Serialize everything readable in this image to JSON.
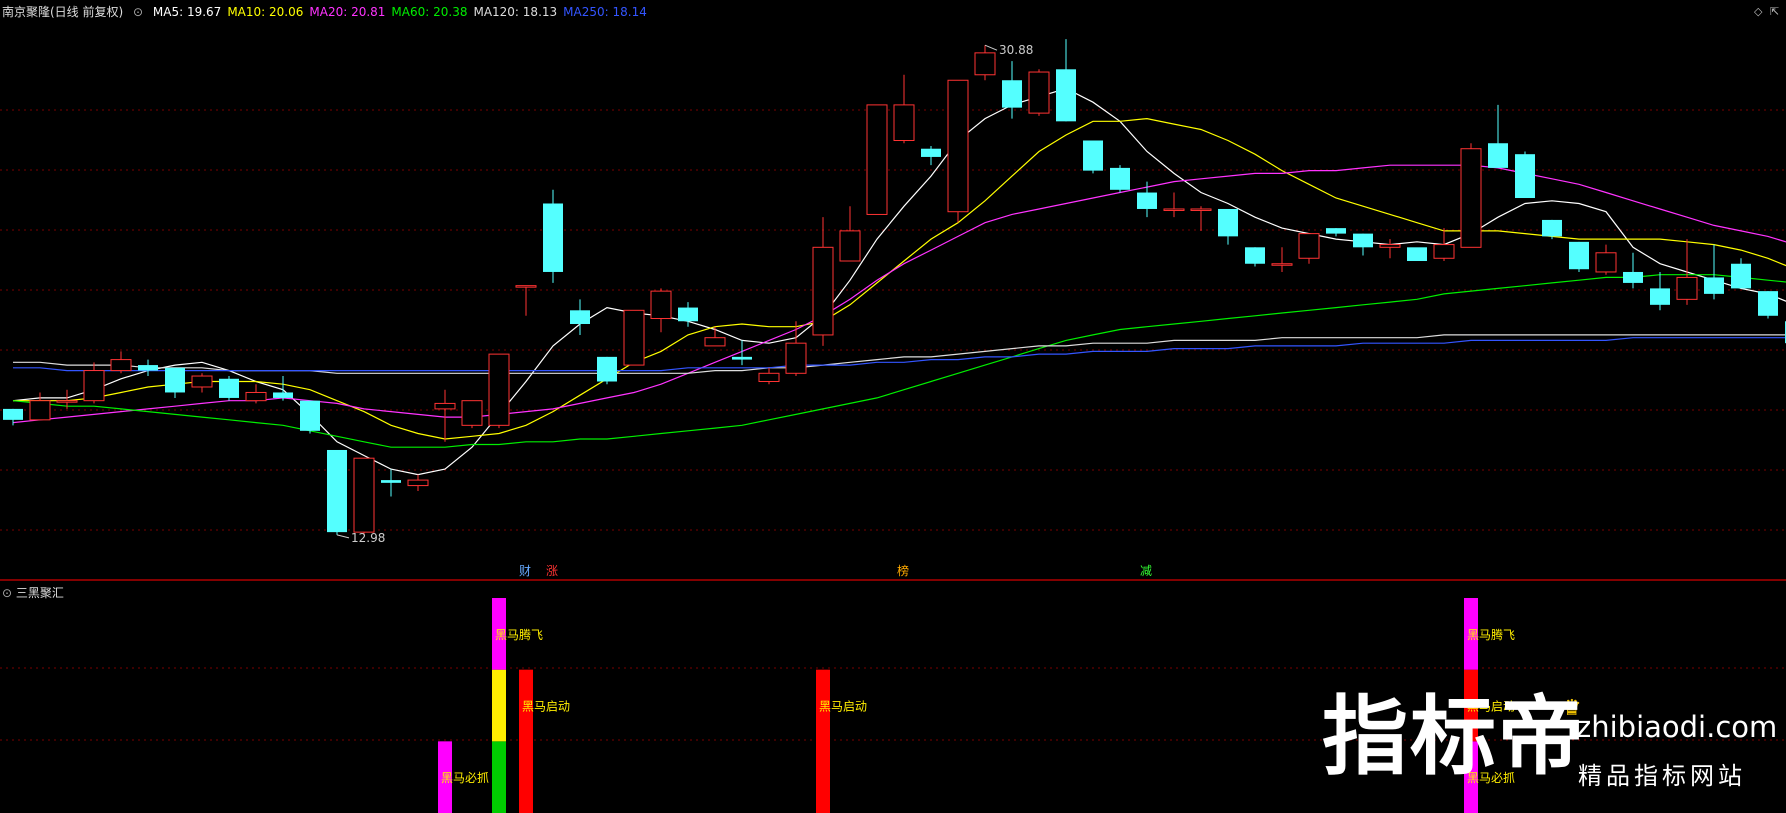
{
  "header": {
    "stock_title": "南京聚隆(日线 前复权)",
    "indicators": [
      {
        "label": "MA5: 19.67",
        "color": "#ffffff"
      },
      {
        "label": "MA10: 20.06",
        "color": "#ffff00"
      },
      {
        "label": "MA20: 20.81",
        "color": "#ff33ff"
      },
      {
        "label": "MA60: 20.38",
        "color": "#00ee00"
      },
      {
        "label": "MA120: 18.13",
        "color": "#dddddd"
      },
      {
        "label": "MA250: 18.14",
        "color": "#3355ff"
      }
    ]
  },
  "sub_panel": {
    "title": "三黑聚汇"
  },
  "watermark": {
    "brand": "指标帝",
    "url": "zhibiaodi.com",
    "slogan": "精品指标网站"
  },
  "colors": {
    "up": "#ff3333",
    "down": "#54ffff",
    "grid": "#7a0000",
    "divider": "#b00000"
  },
  "chart_data": [
    {
      "type": "candlestick",
      "price_range": [
        11.9,
        31.8
      ],
      "high_label": "30.88",
      "low_label": "12.98",
      "candles": [
        [
          17.6,
          17.6,
          17.0,
          17.2
        ],
        [
          17.2,
          18.2,
          17.2,
          17.9
        ],
        [
          17.9,
          18.3,
          17.6,
          17.9
        ],
        [
          17.9,
          19.3,
          17.8,
          19.0
        ],
        [
          19.0,
          19.7,
          18.9,
          19.4
        ],
        [
          19.2,
          19.4,
          18.8,
          19.0
        ],
        [
          19.1,
          19.1,
          18.0,
          18.2
        ],
        [
          18.4,
          18.9,
          18.2,
          18.8
        ],
        [
          18.7,
          18.8,
          17.9,
          18.0
        ],
        [
          17.9,
          18.5,
          17.8,
          18.2
        ],
        [
          18.2,
          18.8,
          17.9,
          18.0
        ],
        [
          17.9,
          17.9,
          16.7,
          16.8
        ],
        [
          16.1,
          16.1,
          13.0,
          13.1
        ],
        [
          13.1,
          15.8,
          13.0,
          15.8
        ],
        [
          15.0,
          15.4,
          14.4,
          14.9
        ],
        [
          14.8,
          15.2,
          14.6,
          15.0
        ],
        [
          17.6,
          18.3,
          16.4,
          17.8
        ],
        [
          17.0,
          17.9,
          16.9,
          17.9
        ],
        [
          17.0,
          19.6,
          16.9,
          19.6
        ],
        [
          22.1,
          22.1,
          21.0,
          22.1
        ],
        [
          25.1,
          25.6,
          22.2,
          22.6
        ],
        [
          21.2,
          21.6,
          20.3,
          20.7
        ],
        [
          19.5,
          19.5,
          18.5,
          18.6
        ],
        [
          19.2,
          21.2,
          19.2,
          21.2
        ],
        [
          20.9,
          22.0,
          20.4,
          21.9
        ],
        [
          21.3,
          21.5,
          20.6,
          20.8
        ],
        [
          19.9,
          20.6,
          19.9,
          20.2
        ],
        [
          19.5,
          20.1,
          19.2,
          19.4
        ],
        [
          18.6,
          19.1,
          18.5,
          18.9
        ],
        [
          18.9,
          20.8,
          18.8,
          20.0
        ],
        [
          20.3,
          24.6,
          19.9,
          23.5
        ],
        [
          23.0,
          25.0,
          23.0,
          24.1
        ],
        [
          24.7,
          28.0,
          24.7,
          28.7
        ],
        [
          27.4,
          29.8,
          27.3,
          28.7
        ],
        [
          27.1,
          27.2,
          26.5,
          26.8
        ],
        [
          24.8,
          29.6,
          24.4,
          29.6
        ],
        [
          29.8,
          30.88,
          29.6,
          30.6
        ],
        [
          29.6,
          30.3,
          28.2,
          28.6
        ],
        [
          28.4,
          30.0,
          28.3,
          29.9
        ],
        [
          30.0,
          31.1,
          28.1,
          28.1
        ],
        [
          27.4,
          27.4,
          26.2,
          26.3
        ],
        [
          26.4,
          26.5,
          25.5,
          25.6
        ],
        [
          25.5,
          25.9,
          24.6,
          24.9
        ],
        [
          24.9,
          25.5,
          24.6,
          24.9
        ],
        [
          24.9,
          25.0,
          24.1,
          24.9
        ],
        [
          24.9,
          24.9,
          23.6,
          23.9
        ],
        [
          23.5,
          23.5,
          22.8,
          22.9
        ],
        [
          22.9,
          23.5,
          22.6,
          22.9
        ],
        [
          23.1,
          24.0,
          22.9,
          24.0
        ],
        [
          24.2,
          24.2,
          23.9,
          24.0
        ],
        [
          24.0,
          24.0,
          23.2,
          23.5
        ],
        [
          23.5,
          23.8,
          23.1,
          23.6
        ],
        [
          23.5,
          23.5,
          23.5,
          23.0
        ],
        [
          23.1,
          24.2,
          23.0,
          23.6
        ],
        [
          23.5,
          27.3,
          23.5,
          27.1
        ],
        [
          27.3,
          28.7,
          26.4,
          26.4
        ],
        [
          26.9,
          27.0,
          25.3,
          25.3
        ],
        [
          24.5,
          24.5,
          23.8,
          23.9
        ],
        [
          23.7,
          23.7,
          22.6,
          22.7
        ],
        [
          22.6,
          23.6,
          22.5,
          23.3
        ],
        [
          22.6,
          23.3,
          22.0,
          22.2
        ],
        [
          22.0,
          22.6,
          21.2,
          21.4
        ],
        [
          21.6,
          23.8,
          21.4,
          22.4
        ],
        [
          22.4,
          23.6,
          21.6,
          21.8
        ],
        [
          22.9,
          23.1,
          22.0,
          22.0
        ],
        [
          21.9,
          21.9,
          20.9,
          21.0
        ],
        [
          20.8,
          20.8,
          19.9,
          20.0
        ]
      ],
      "moving_averages": [
        {
          "name": "MA5",
          "color": "#ffffff",
          "values": [
            17.9,
            18.0,
            18.0,
            18.3,
            18.7,
            19.0,
            19.2,
            19.3,
            19.0,
            18.6,
            18.3,
            17.4,
            16.4,
            15.9,
            15.4,
            15.2,
            15.4,
            16.2,
            17.4,
            18.6,
            19.9,
            20.7,
            21.3,
            21.1,
            21.0,
            20.8,
            20.5,
            20.1,
            20.0,
            20.2,
            21.0,
            22.3,
            23.8,
            25.0,
            26.1,
            27.4,
            28.2,
            28.7,
            29.0,
            29.3,
            28.8,
            28.1,
            27.0,
            26.2,
            25.5,
            25.1,
            24.6,
            24.2,
            24.0,
            23.8,
            23.7,
            23.6,
            23.7,
            23.6,
            24.0,
            24.6,
            25.1,
            25.2,
            25.1,
            24.8,
            23.5,
            22.9,
            22.6,
            22.3,
            22.0,
            21.8,
            21.4
          ]
        },
        {
          "name": "MA10",
          "color": "#ffff00",
          "values": [
            17.9,
            17.9,
            17.9,
            18.0,
            18.2,
            18.4,
            18.5,
            18.6,
            18.6,
            18.6,
            18.5,
            18.3,
            17.9,
            17.5,
            17.0,
            16.7,
            16.5,
            16.6,
            16.7,
            17.0,
            17.5,
            18.1,
            18.7,
            19.3,
            19.7,
            20.3,
            20.6,
            20.7,
            20.6,
            20.6,
            20.8,
            21.4,
            22.2,
            23.0,
            23.8,
            24.4,
            25.2,
            26.1,
            27.0,
            27.6,
            28.1,
            28.1,
            28.2,
            28.0,
            27.8,
            27.4,
            26.9,
            26.3,
            25.8,
            25.3,
            25.0,
            24.7,
            24.4,
            24.1,
            24.1,
            24.1,
            24.0,
            23.9,
            23.8,
            23.8,
            23.8,
            23.8,
            23.7,
            23.6,
            23.4,
            23.1,
            22.7
          ]
        },
        {
          "name": "MA20",
          "color": "#ff33ff",
          "values": [
            17.1,
            17.2,
            17.3,
            17.4,
            17.5,
            17.6,
            17.7,
            17.8,
            17.9,
            17.9,
            18.0,
            17.9,
            17.8,
            17.6,
            17.5,
            17.4,
            17.3,
            17.3,
            17.4,
            17.5,
            17.6,
            17.8,
            18.0,
            18.2,
            18.5,
            18.9,
            19.3,
            19.7,
            20.1,
            20.5,
            21.0,
            21.6,
            22.3,
            22.9,
            23.4,
            23.9,
            24.4,
            24.7,
            24.9,
            25.1,
            25.3,
            25.5,
            25.7,
            25.9,
            26.0,
            26.1,
            26.2,
            26.2,
            26.3,
            26.3,
            26.4,
            26.5,
            26.5,
            26.5,
            26.5,
            26.4,
            26.2,
            26.0,
            25.8,
            25.5,
            25.2,
            24.9,
            24.6,
            24.3,
            24.1,
            23.9,
            23.6
          ]
        },
        {
          "name": "MA60",
          "color": "#00ee00",
          "values": [
            17.9,
            17.8,
            17.7,
            17.7,
            17.6,
            17.5,
            17.4,
            17.3,
            17.2,
            17.1,
            17.0,
            16.8,
            16.6,
            16.4,
            16.2,
            16.2,
            16.2,
            16.3,
            16.3,
            16.4,
            16.4,
            16.5,
            16.5,
            16.6,
            16.7,
            16.8,
            16.9,
            17.0,
            17.2,
            17.4,
            17.6,
            17.8,
            18.0,
            18.3,
            18.6,
            18.9,
            19.2,
            19.5,
            19.8,
            20.1,
            20.3,
            20.5,
            20.6,
            20.7,
            20.8,
            20.9,
            21.0,
            21.1,
            21.2,
            21.3,
            21.4,
            21.5,
            21.6,
            21.8,
            21.9,
            22.0,
            22.1,
            22.2,
            22.3,
            22.4,
            22.4,
            22.5,
            22.5,
            22.5,
            22.4,
            22.3,
            22.2
          ]
        },
        {
          "name": "MA120",
          "color": "#dddddd",
          "values": [
            19.3,
            19.3,
            19.2,
            19.2,
            19.2,
            19.1,
            19.1,
            19.1,
            19.0,
            19.0,
            19.0,
            19.0,
            18.9,
            18.9,
            18.9,
            18.9,
            18.9,
            18.9,
            18.9,
            18.9,
            18.9,
            18.9,
            18.9,
            18.9,
            18.9,
            18.9,
            19.0,
            19.0,
            19.1,
            19.1,
            19.2,
            19.3,
            19.4,
            19.5,
            19.5,
            19.6,
            19.7,
            19.8,
            19.9,
            19.9,
            20.0,
            20.0,
            20.0,
            20.1,
            20.1,
            20.1,
            20.1,
            20.2,
            20.2,
            20.2,
            20.2,
            20.2,
            20.2,
            20.3,
            20.3,
            20.3,
            20.3,
            20.3,
            20.3,
            20.3,
            20.3,
            20.3,
            20.3,
            20.3,
            20.3,
            20.3,
            20.3
          ]
        },
        {
          "name": "MA250",
          "color": "#3355ff",
          "values": [
            19.1,
            19.1,
            19.0,
            19.0,
            19.0,
            19.0,
            19.0,
            19.0,
            19.0,
            19.0,
            19.0,
            19.0,
            19.0,
            19.0,
            19.0,
            19.0,
            19.0,
            19.0,
            19.0,
            19.0,
            19.0,
            19.0,
            19.0,
            19.0,
            19.0,
            19.1,
            19.1,
            19.1,
            19.1,
            19.2,
            19.2,
            19.2,
            19.3,
            19.3,
            19.4,
            19.4,
            19.5,
            19.5,
            19.6,
            19.6,
            19.7,
            19.7,
            19.7,
            19.8,
            19.8,
            19.8,
            19.9,
            19.9,
            19.9,
            19.9,
            20.0,
            20.0,
            20.0,
            20.0,
            20.1,
            20.1,
            20.1,
            20.1,
            20.1,
            20.1,
            20.2,
            20.2,
            20.2,
            20.2,
            20.2,
            20.2,
            20.2
          ]
        }
      ],
      "event_markers": [
        {
          "index": 19,
          "label": "财",
          "color": "#66aaff"
        },
        {
          "index": 20,
          "label": "涨",
          "color": "#ff3333"
        },
        {
          "index": 33,
          "label": "榜",
          "color": "#ffaa00"
        },
        {
          "index": 42,
          "label": "减",
          "color": "#33ff33"
        }
      ]
    },
    {
      "type": "bar",
      "title": "三黑聚汇",
      "range": [
        0,
        3
      ],
      "bars": [
        {
          "index": 16,
          "segments": [
            {
              "from": 0,
              "to": 1,
              "color": "#ff00ff"
            }
          ]
        },
        {
          "index": 18,
          "segments": [
            {
              "from": 0,
              "to": 1,
              "color": "#00cc00"
            },
            {
              "from": 1,
              "to": 2,
              "color": "#ffee00"
            },
            {
              "from": 2,
              "to": 3,
              "color": "#ff00ff"
            }
          ]
        },
        {
          "index": 19,
          "segments": [
            {
              "from": 0,
              "to": 2,
              "color": "#ff0000"
            }
          ]
        },
        {
          "index": 30,
          "segments": [
            {
              "from": 0,
              "to": 2,
              "color": "#ff0000"
            }
          ]
        },
        {
          "index": 54,
          "segments": [
            {
              "from": 0,
              "to": 1,
              "color": "#ff00ff"
            },
            {
              "from": 1,
              "to": 2,
              "color": "#ff0000"
            },
            {
              "from": 2,
              "to": 3,
              "color": "#ff00ff"
            }
          ]
        }
      ],
      "labels": [
        {
          "index": 16,
          "level": 0.5,
          "text": "黑马必抓"
        },
        {
          "index": 18,
          "level": 2.5,
          "text": "黑马腾飞"
        },
        {
          "index": 19,
          "level": 1.5,
          "text": "黑马启动"
        },
        {
          "index": 30,
          "level": 1.5,
          "text": "黑马启动"
        },
        {
          "index": 54,
          "level": 2.5,
          "text": "黑马腾飞"
        },
        {
          "index": 54,
          "level": 1.5,
          "text": "黑马启动"
        },
        {
          "index": 54,
          "level": 0.5,
          "text": "黑马必抓"
        }
      ]
    }
  ]
}
